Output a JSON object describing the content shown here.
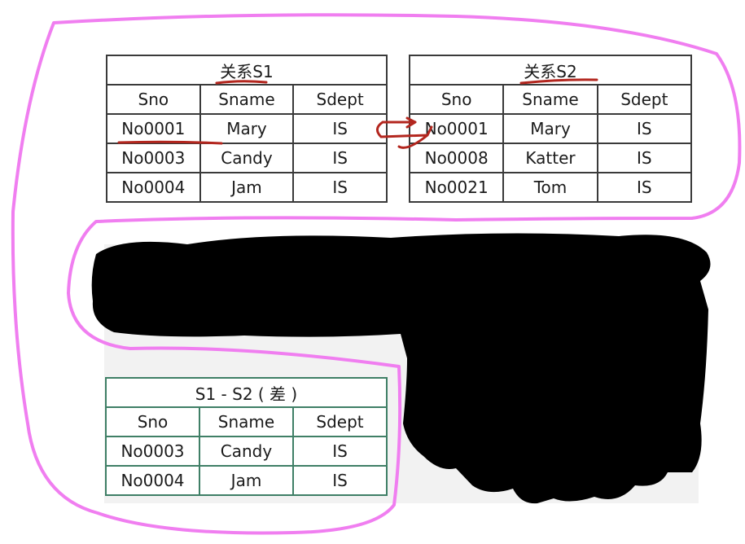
{
  "s1": {
    "title": "关系S1",
    "headers": [
      "Sno",
      "Sname",
      "Sdept"
    ],
    "rows": [
      [
        "No0001",
        "Mary",
        "IS"
      ],
      [
        "No0003",
        "Candy",
        "IS"
      ],
      [
        "No0004",
        "Jam",
        "IS"
      ]
    ]
  },
  "s2": {
    "title": "关系S2",
    "headers": [
      "Sno",
      "Sname",
      "Sdept"
    ],
    "rows": [
      [
        "No0001",
        "Mary",
        "IS"
      ],
      [
        "No0008",
        "Katter",
        "IS"
      ],
      [
        "No0021",
        "Tom",
        "IS"
      ]
    ]
  },
  "difference": {
    "title": "S1 - S2 ( 差 )",
    "headers": [
      "Sno",
      "Sname",
      "Sdept"
    ],
    "rows": [
      [
        "No0003",
        "Candy",
        "IS"
      ],
      [
        "No0004",
        "Jam",
        "IS"
      ]
    ]
  },
  "colors": {
    "pink_outline": "#f07ef0",
    "red_annotation": "#b3261e",
    "redaction": "#000000",
    "green_border": "#3f7f66"
  }
}
